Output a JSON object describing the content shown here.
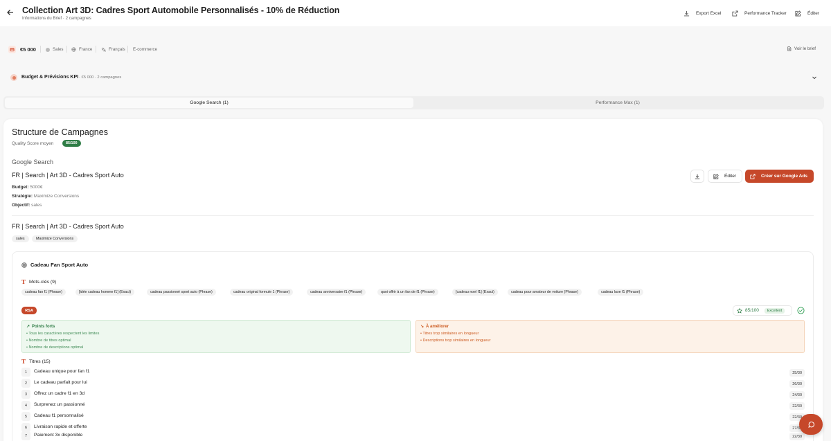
{
  "header": {
    "title": "Collection Art 3D: Cadres Sport Automobile Personnalisés - 10% de Réduction",
    "subtitle": "Informations du Brief · 2 campagnes",
    "buttons": {
      "export": "Export Excel",
      "tracker": "Performance Tracker",
      "edit": "Éditer"
    }
  },
  "info": {
    "budget": "€5 000",
    "objective": "Sales",
    "country": "France",
    "language": "Français",
    "industry": "E-commerce",
    "view_brief": "Voir le brief"
  },
  "budget_kpi": {
    "title": "Budget & Prévisions KPI",
    "summary": "· €5 000 · 2 campagnes"
  },
  "tabs": [
    {
      "label": "Google Search (1)",
      "active": true
    },
    {
      "label": "Performance Max (1)",
      "active": false
    }
  ],
  "structure": {
    "title": "Structure de Campagnes",
    "quality_label": "Quality Score moyen",
    "quality_value": "85/100",
    "network": "Google Search",
    "campaign_name": "FR | Search | Art 3D - Cadres Sport Auto",
    "budget_label": "Budget:",
    "budget_value": " 5000€",
    "strategy_label": "Stratégie:",
    "strategy_value": " Maximize Conversions",
    "objective_label": "Objectif:",
    "objective_value": " sales",
    "edit_label": "Éditer",
    "create_label": "Créer sur Google Ads",
    "campaign_name_2": "FR | Search | Art 3D - Cadres Sport Auto",
    "tags": [
      "sales",
      "Maximize Conversions"
    ]
  },
  "ad_group": {
    "title": "Cadeau Fan Sport Auto",
    "keywords_label": "Mots-clés (9)",
    "keywords": [
      "cadeau fan f1 (Phrase)",
      "[idée cadeau homme f1] (Exact)",
      "cadeau passionné sport auto (Phrase)",
      "cadeau original formule 1 (Phrase)",
      "cadeau anniversaire f1 (Phrase)",
      "quoi offrir à un fan de f1 (Phrase)",
      "[cadeau noel f1] (Exact)",
      "cadeau pour amateur de voiture (Phrase)",
      "cadeau luxe f1 (Phrase)"
    ],
    "ad_type": "RSA",
    "score": "85/100",
    "score_label": "Excellent",
    "strengths_title": "Points forts",
    "strengths": [
      "• Tous les caractères respectent les limites",
      "• Nombre de titres optimal",
      "• Nombre de descriptions optimal"
    ],
    "improve_title": "À améliorer",
    "improvements": [
      "• Titres trop similaires en longueur",
      "• Descriptions trop similaires en longueur"
    ],
    "titles_label": "Titres (15)",
    "titles": [
      {
        "n": "1",
        "text": "Cadeau unique pour fan f1",
        "count": "25/30"
      },
      {
        "n": "2",
        "text": "Le cadeau parfait pour lui",
        "count": "26/30"
      },
      {
        "n": "3",
        "text": "Offrez un cadre f1 en 3d",
        "count": "24/30"
      },
      {
        "n": "4",
        "text": "Surprenez un passionné",
        "count": "22/30"
      },
      {
        "n": "5",
        "text": "Cadeau f1 personnalisé",
        "count": "22/30"
      },
      {
        "n": "6",
        "text": "Livraison rapide et offerte",
        "count": "27/30"
      },
      {
        "n": "7",
        "text": "Paiement 3x disponible",
        "count": "22/30"
      }
    ]
  },
  "colors": {
    "accent": "#c6482a",
    "success": "#2f7d46",
    "warning": "#cc5a20"
  }
}
